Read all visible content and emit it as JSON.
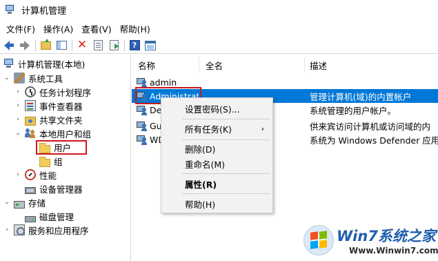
{
  "window": {
    "title": "计算机管理"
  },
  "menubar": [
    "文件(F)",
    "操作(A)",
    "查看(V)",
    "帮助(H)"
  ],
  "toolbar": {
    "icons": [
      "back-arrow-icon",
      "forward-arrow-icon",
      "up-folder-icon",
      "show-hide-tree-icon",
      "delete-icon",
      "properties-icon",
      "export-list-icon",
      "help-icon",
      "show-hide-action-pane-icon"
    ]
  },
  "tree": {
    "root": "计算机管理(本地)",
    "system_tools": "系统工具",
    "task_scheduler": "任务计划程序",
    "event_viewer": "事件查看器",
    "shared_folders": "共享文件夹",
    "local_users_groups": "本地用户和组",
    "users": "用户",
    "groups": "组",
    "performance": "性能",
    "device_manager": "设备管理器",
    "storage": "存储",
    "disk_management": "磁盘管理",
    "services_apps": "服务和应用程序"
  },
  "list": {
    "columns": {
      "name": "名称",
      "fullname": "全名",
      "description": "描述"
    },
    "rows": [
      {
        "name": "admin",
        "fullname": "",
        "description": ""
      },
      {
        "name": "Administrat",
        "fullname": "",
        "description": "管理计算机(域)的内置帐户"
      },
      {
        "name": "Def",
        "fullname": "",
        "description": "系统管理的用户帐户。"
      },
      {
        "name": "Gue",
        "fullname": "",
        "description": "供来宾访问计算机或访问域的内"
      },
      {
        "name": "WD",
        "fullname": "",
        "description": "系统为 Windows Defender 应用..."
      }
    ]
  },
  "context_menu": {
    "set_password": "设置密码(S)...",
    "all_tasks": "所有任务(K)",
    "all_tasks_arrow": "›",
    "delete": "删除(D)",
    "rename": "重命名(M)",
    "properties": "属性(R)",
    "help": "帮助(H)"
  },
  "watermark": {
    "title": "Win7系统之家",
    "url": "Www.Winwin7.com"
  },
  "colors": {
    "selection": "#0078d7",
    "highlight_box": "#d0161b",
    "watermark_blue": "#1f5fae"
  }
}
